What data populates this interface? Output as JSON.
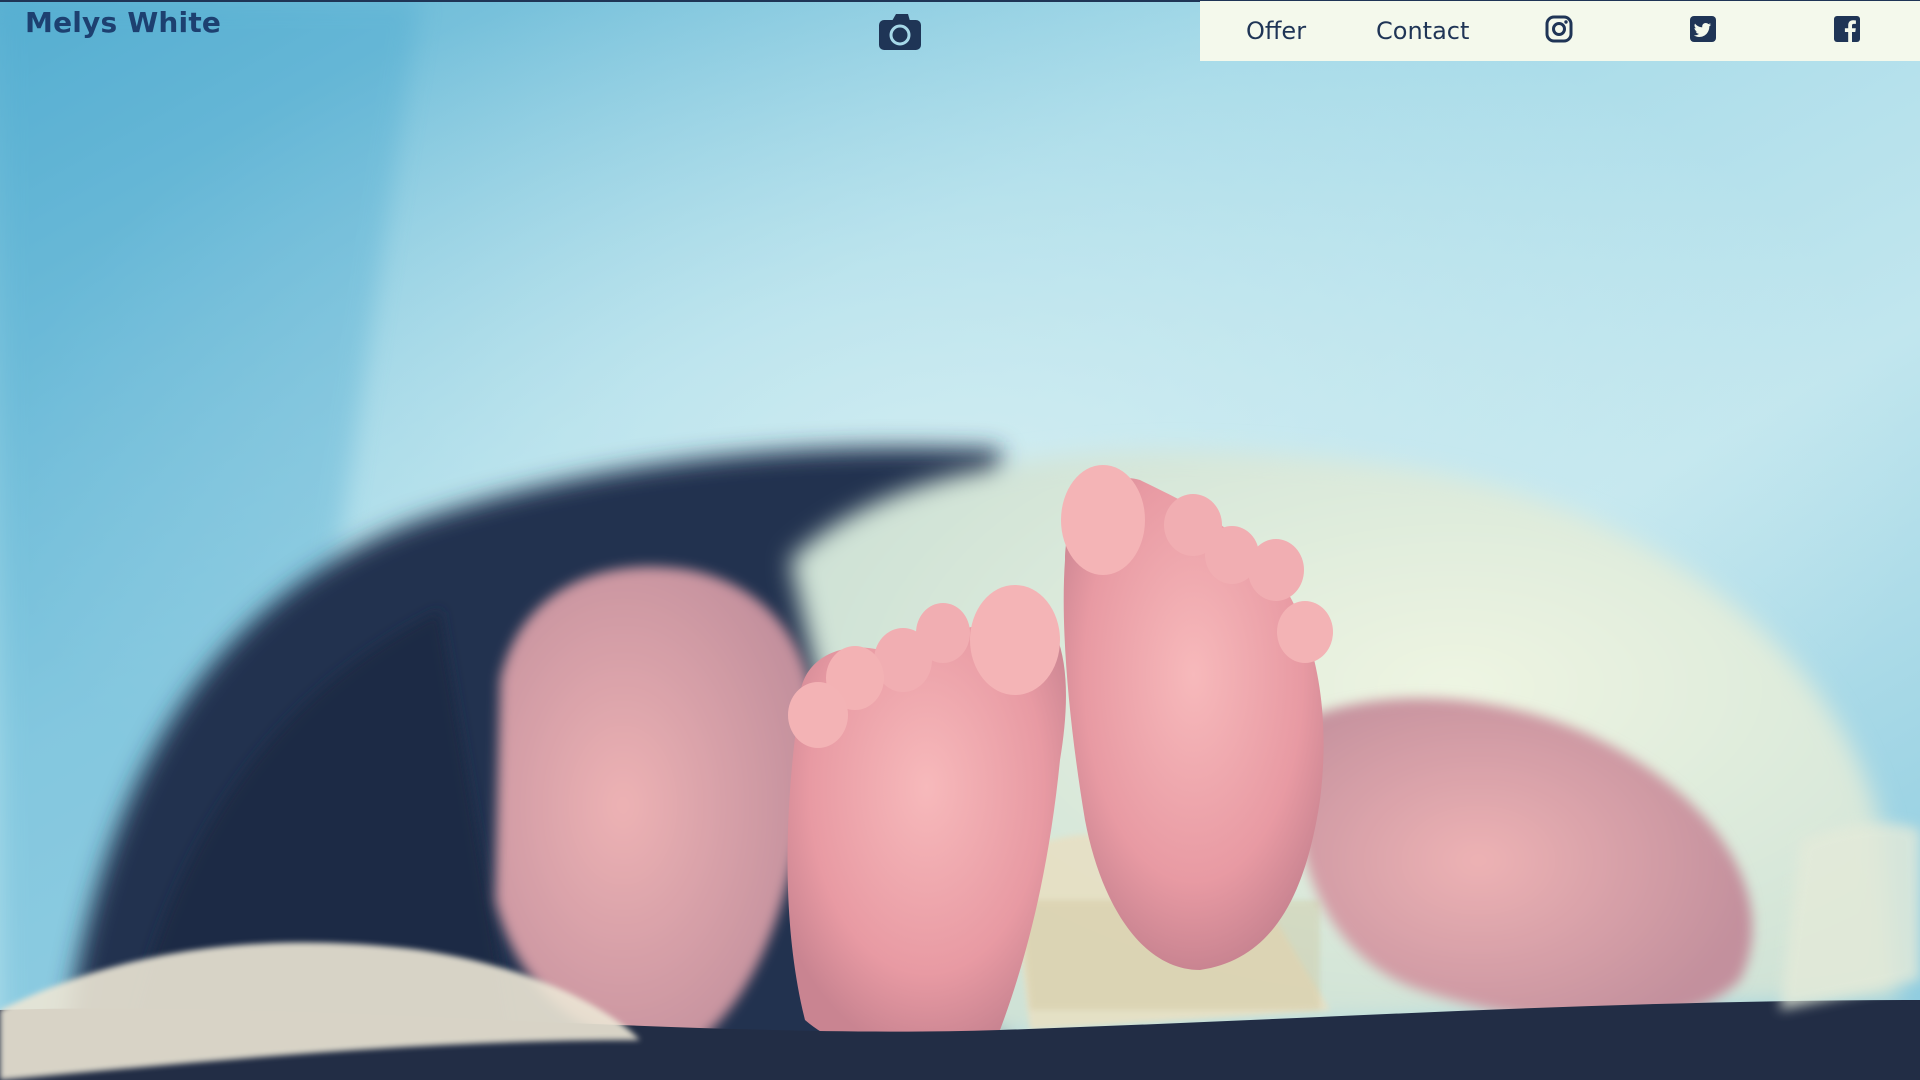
{
  "site": {
    "title": "Melys White"
  },
  "header": {
    "camera_icon": "camera-icon"
  },
  "nav": {
    "items": [
      {
        "label": "Offer"
      },
      {
        "label": "Contact"
      }
    ],
    "social": [
      {
        "icon": "instagram-icon"
      },
      {
        "icon": "twitter-icon"
      },
      {
        "icon": "facebook-icon"
      }
    ]
  },
  "colors": {
    "brand_text": "#1d4070",
    "nav_background": "#f4f9ec",
    "nav_text": "#1f3556",
    "hero_sky": "#7cc3da"
  }
}
